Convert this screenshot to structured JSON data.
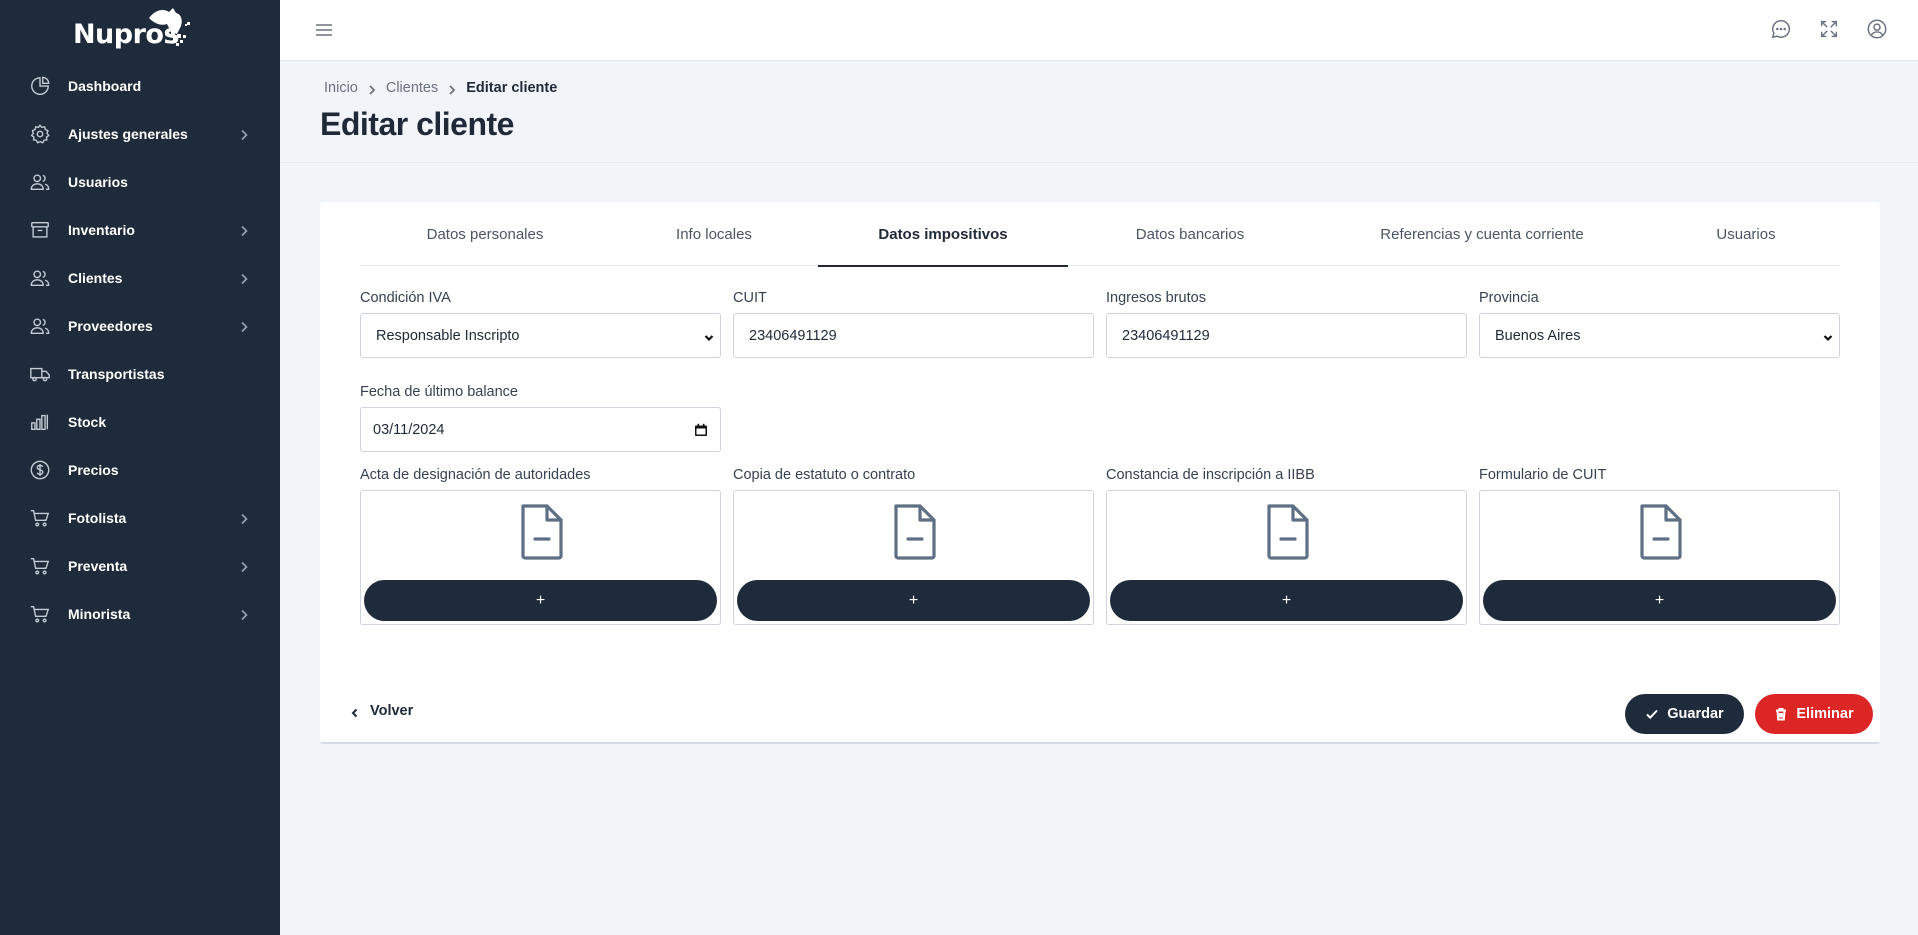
{
  "brand": {
    "name": "Nupros"
  },
  "sidebar": {
    "items": [
      {
        "label": "Dashboard",
        "icon": "pie-chart-icon",
        "has_children": false
      },
      {
        "label": "Ajustes generales",
        "icon": "gear-icon",
        "has_children": true
      },
      {
        "label": "Usuarios",
        "icon": "users-icon",
        "has_children": false
      },
      {
        "label": "Inventario",
        "icon": "archive-icon",
        "has_children": true
      },
      {
        "label": "Clientes",
        "icon": "users-icon",
        "has_children": true
      },
      {
        "label": "Proveedores",
        "icon": "users-icon",
        "has_children": true
      },
      {
        "label": "Transportistas",
        "icon": "truck-icon",
        "has_children": false
      },
      {
        "label": "Stock",
        "icon": "bar-chart-icon",
        "has_children": false
      },
      {
        "label": "Precios",
        "icon": "dollar-icon",
        "has_children": false
      },
      {
        "label": "Fotolista",
        "icon": "cart-icon",
        "has_children": true
      },
      {
        "label": "Preventa",
        "icon": "cart-icon",
        "has_children": true
      },
      {
        "label": "Minorista",
        "icon": "cart-icon",
        "has_children": true
      }
    ]
  },
  "topbar": {
    "icons": [
      "chat-icon",
      "fullscreen-icon",
      "user-circle-icon"
    ]
  },
  "breadcrumb": [
    "Inicio",
    "Clientes",
    "Editar cliente"
  ],
  "page": {
    "title": "Editar cliente"
  },
  "tabs": [
    {
      "label": "Datos personales",
      "active": false
    },
    {
      "label": "Info locales",
      "active": false
    },
    {
      "label": "Datos impositivos",
      "active": true
    },
    {
      "label": "Datos bancarios",
      "active": false
    },
    {
      "label": "Referencias y cuenta corriente",
      "active": false
    },
    {
      "label": "Usuarios",
      "active": false
    }
  ],
  "form": {
    "condicion_iva": {
      "label": "Condición IVA",
      "value": "Responsable Inscripto"
    },
    "cuit": {
      "label": "CUIT",
      "value": "23406491129"
    },
    "ingresos_brutos": {
      "label": "Ingresos brutos",
      "value": "23406491129"
    },
    "provincia": {
      "label": "Provincia",
      "value": "Buenos Aires"
    },
    "fecha_balance": {
      "label": "Fecha de último balance",
      "value": "03/11/2024"
    }
  },
  "uploads": [
    {
      "label": "Acta de designación de autoridades",
      "button": "+"
    },
    {
      "label": "Copia de estatuto o contrato",
      "button": "+"
    },
    {
      "label": "Constancia de inscripción a IIBB",
      "button": "+"
    },
    {
      "label": "Formulario de CUIT",
      "button": "+"
    }
  ],
  "actions": {
    "back": "Volver",
    "save": "Guardar",
    "delete": "Eliminar"
  },
  "colors": {
    "sidebar_bg": "#1f2a3a",
    "primary": "#1f2a3a",
    "danger": "#dc2626",
    "page_bg": "#f1f4f8"
  }
}
